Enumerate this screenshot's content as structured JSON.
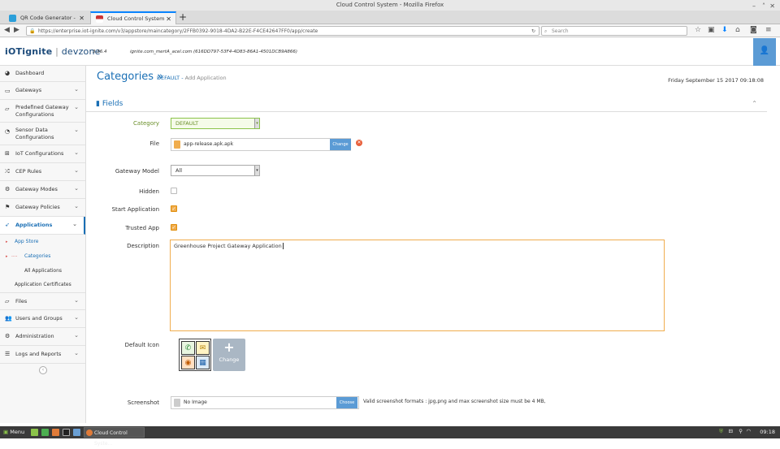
{
  "window": {
    "title": "Cloud Control System - Mozilla Firefox"
  },
  "tabs": [
    {
      "label": "QR Code Generator - Creat",
      "active": false
    },
    {
      "label": "Cloud Control System",
      "active": true
    }
  ],
  "nav": {
    "url": "https://enterprise.iot-ignite.com/v3/appstore/maincategory/2FFB0392-9018-4DA2-B22E-F4CE42647FF0/app/create",
    "search_placeholder": "Search"
  },
  "header": {
    "logo_main": "iOTignite",
    "logo_sub": "devzone",
    "version": "3.36.4",
    "user": "ignite.com_mertA_acel.com (616DD797-53F4-4D83-86A1-4501DCB9A866)"
  },
  "sidebar": {
    "items": [
      {
        "label": "Dashboard",
        "icon": "dashboard-icon"
      },
      {
        "label": "Gateways",
        "icon": "gateway-icon"
      },
      {
        "label": "Predefined Gateway Configurations",
        "icon": "folder-icon"
      },
      {
        "label": "Sensor Data Configurations",
        "icon": "rss-icon"
      },
      {
        "label": "IoT Configurations",
        "icon": "sitemap-icon"
      },
      {
        "label": "CEP Rules",
        "icon": "shuffle-icon"
      },
      {
        "label": "Gateway Modes",
        "icon": "gear-icon"
      },
      {
        "label": "Gateway Policies",
        "icon": "flag-icon"
      },
      {
        "label": "Applications",
        "icon": "rocket-icon"
      },
      {
        "label": "Files",
        "icon": "folder-icon"
      },
      {
        "label": "Users and Groups",
        "icon": "users-icon"
      },
      {
        "label": "Administration",
        "icon": "gears-icon"
      },
      {
        "label": "Logs and Reports",
        "icon": "list-icon"
      }
    ],
    "sub_app_store": "App Store",
    "sub_categories": "Categories",
    "sub_all_applications": "All Applications",
    "sub_certificates": "Application Certificates"
  },
  "main": {
    "title": "Categories",
    "crumb_category": "DEFAULT",
    "crumb_action": "Add Application",
    "date": "Friday September 15 2017 09:18:08",
    "fields_title": "Fields",
    "form": {
      "category_label": "Category",
      "category_value": "DEFAULT",
      "file_label": "File",
      "file_name": "app-release.apk.apk",
      "change_label": "Change",
      "gateway_model_label": "Gateway Model",
      "gateway_model_value": "All",
      "hidden_label": "Hidden",
      "hidden_checked": false,
      "start_app_label": "Start Application",
      "start_app_checked": true,
      "trusted_app_label": "Trusted App",
      "trusted_app_checked": true,
      "description_label": "Description",
      "description_value": "Greenhouse Project Gateway Application",
      "default_icon_label": "Default Icon",
      "icon_change_label": "Change",
      "screenshot_label": "Screenshot",
      "screenshot_value": "No Image",
      "screenshot_button": "Choose",
      "screenshot_note": "Valid screenshot formats : jpg,png and max screenshot size must be 4 MB,"
    }
  },
  "taskbar": {
    "menu": "Menu",
    "task": "Cloud Control Syste...",
    "clock": "09:18"
  },
  "colors": {
    "accent": "#1a6fb5",
    "warning": "#f0ad4e",
    "button": "#5b9bd5"
  }
}
